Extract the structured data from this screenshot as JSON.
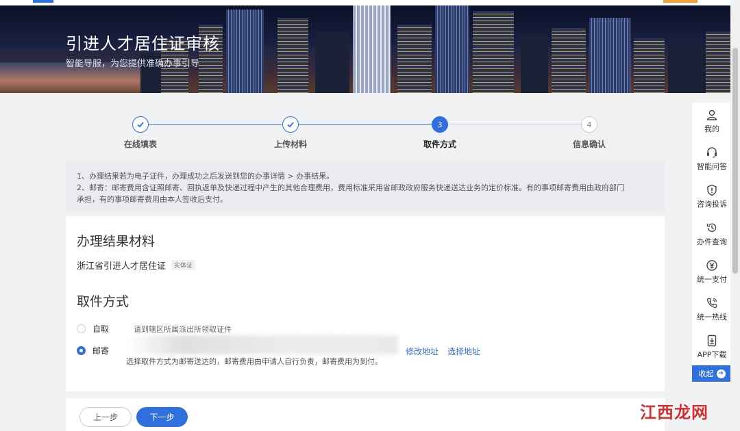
{
  "banner": {
    "title": "引进人才居住证审核",
    "subtitle": "智能导服，为您提供准确办事引导"
  },
  "steps": [
    {
      "number": "1",
      "label": "在线填表",
      "status": "done"
    },
    {
      "number": "2",
      "label": "上传材料",
      "status": "done"
    },
    {
      "number": "3",
      "label": "取件方式",
      "status": "active"
    },
    {
      "number": "4",
      "label": "信息确认",
      "status": "pending"
    }
  ],
  "notice": {
    "line1": "1、办理结果若为电子证件，办理成功之后发送到您的办事详情 > 办事结果。",
    "line2": "2、邮寄：邮寄费用含证照邮寄、回执返单及快递过程中产生的其他合理费用，费用标准采用省邮政政府服务快递送达业务的定价标准。有的事项邮寄费用由政府部门",
    "line3": "承担，有的事项邮寄费用由本人签收后支付。"
  },
  "result_section": {
    "title": "办理结果材料",
    "material_name": "浙江省引进人才居住证",
    "material_tag": "实体证"
  },
  "pickup_section": {
    "title": "取件方式",
    "options": [
      {
        "label": "自取",
        "desc": "请到辖区所属派出所领取证件",
        "selected": false
      },
      {
        "label": "邮寄",
        "desc": "",
        "selected": true
      }
    ],
    "modify_address": "修改地址",
    "select_address": "选择地址",
    "mail_note": "选择取件方式为邮寄送达的，邮寄费用由申请人自行负责，邮寄费用为到付。"
  },
  "buttons": {
    "prev": "上一步",
    "next": "下一步"
  },
  "sidebar": {
    "items": [
      {
        "label": "我的",
        "icon": "user-icon"
      },
      {
        "label": "智能问答",
        "icon": "headset-icon"
      },
      {
        "label": "咨询投诉",
        "icon": "shield-alert-icon"
      },
      {
        "label": "办件查询",
        "icon": "history-icon"
      },
      {
        "label": "统一支付",
        "icon": "yen-icon"
      },
      {
        "label": "统一热线",
        "icon": "phone-icon"
      },
      {
        "label": "APP下载",
        "icon": "download-icon"
      }
    ],
    "collapse": "收起"
  },
  "watermark": "江西龙网",
  "colors": {
    "accent": "#2f6fde",
    "watermark": "#d32f2f"
  }
}
